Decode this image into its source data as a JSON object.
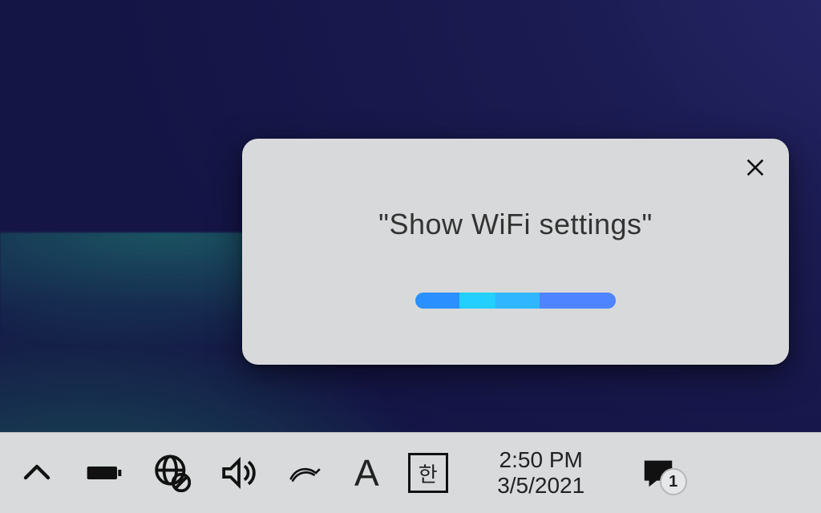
{
  "popup": {
    "text": "\"Show WiFi settings\"",
    "icons": {
      "close": "close-icon"
    }
  },
  "taskbar": {
    "chevron_up": "show-hidden-icons",
    "battery": "battery-icon",
    "network": "network-blocked-icon",
    "volume": "volume-icon",
    "ink": "windows-ink-icon",
    "ime_letter": "A",
    "ime_hangul": "한",
    "time": "2:50 PM",
    "date": "3/5/2021",
    "action_center": {
      "label": "action-center-icon",
      "badge": "1"
    }
  }
}
